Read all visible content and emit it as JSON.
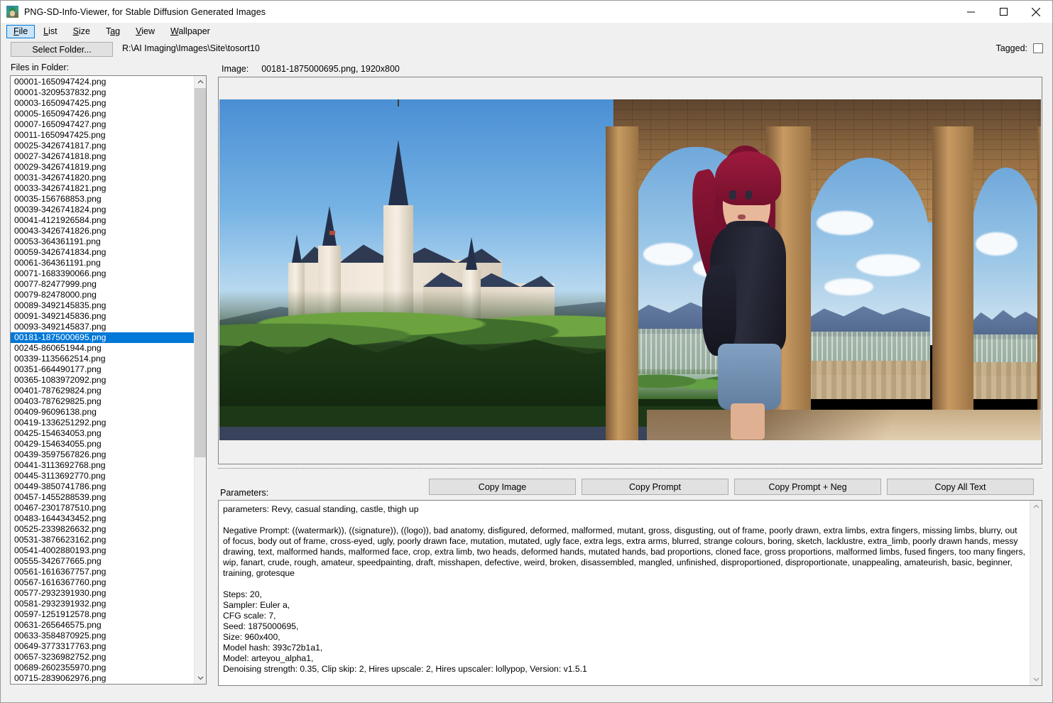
{
  "window": {
    "title": "PNG-SD-Info-Viewer, for Stable Diffusion Generated Images",
    "icon": "app-icon",
    "minimize_label": "Minimize",
    "maximize_label": "Maximize",
    "close_label": "Close"
  },
  "menu": {
    "items": [
      {
        "label": "File",
        "accel": "F",
        "focused": true
      },
      {
        "label": "List",
        "accel": "L",
        "focused": false
      },
      {
        "label": "Size",
        "accel": "S",
        "focused": false
      },
      {
        "label": "Tag",
        "accel": "a",
        "focused": false
      },
      {
        "label": "View",
        "accel": "V",
        "focused": false
      },
      {
        "label": "Wallpaper",
        "accel": "W",
        "focused": false
      }
    ]
  },
  "toolbar": {
    "select_folder_label": "Select Folder...",
    "folder_path": "R:\\AI Imaging\\Images\\Site\\tosort10",
    "tagged_label": "Tagged:",
    "tagged_checked": false
  },
  "file_panel": {
    "label": "Files in Folder:",
    "selected": "00181-1875000695.png",
    "files": [
      "00001-1650947424.png",
      "00001-3209537832.png",
      "00003-1650947425.png",
      "00005-1650947426.png",
      "00007-1650947427.png",
      "00011-1650947425.png",
      "00025-3426741817.png",
      "00027-3426741818.png",
      "00029-3426741819.png",
      "00031-3426741820.png",
      "00033-3426741821.png",
      "00035-156768853.png",
      "00039-3426741824.png",
      "00041-4121926584.png",
      "00043-3426741826.png",
      "00053-364361191.png",
      "00059-3426741834.png",
      "00061-364361191.png",
      "00071-1683390066.png",
      "00077-82477999.png",
      "00079-82478000.png",
      "00089-3492145835.png",
      "00091-3492145836.png",
      "00093-3492145837.png",
      "00181-1875000695.png",
      "00245-860651944.png",
      "00339-1135662514.png",
      "00351-664490177.png",
      "00365-1083972092.png",
      "00401-787629824.png",
      "00403-787629825.png",
      "00409-96096138.png",
      "00419-1336251292.png",
      "00425-154634053.png",
      "00429-154634055.png",
      "00439-3597567826.png",
      "00441-3113692768.png",
      "00445-3113692770.png",
      "00449-3850741786.png",
      "00457-1455288539.png",
      "00467-2301787510.png",
      "00483-1644343452.png",
      "00525-2339826632.png",
      "00531-3876623162.png",
      "00541-4002880193.png",
      "00555-342677665.png",
      "00561-1616367757.png",
      "00567-1616367760.png",
      "00577-2932391930.png",
      "00581-2932391932.png",
      "00597-1251912578.png",
      "00631-265646575.png",
      "00633-3584870925.png",
      "00649-3773317763.png",
      "00657-3236982752.png",
      "00689-2602355970.png",
      "00715-2839062976.png"
    ]
  },
  "preview": {
    "image_label": "Image:",
    "image_info": "00181-1875000695.png, 1920x800"
  },
  "actions": {
    "copy_image": "Copy Image",
    "copy_prompt": "Copy Prompt",
    "copy_prompt_neg": "Copy Prompt + Neg",
    "copy_all_text": "Copy All Text"
  },
  "parameters": {
    "label": "Parameters:",
    "prompt_line": "parameters: Revy, casual standing, castle, thigh up",
    "negative_prompt": "Negative Prompt: ((watermark)), ((signature)), ((logo)), bad anatomy, disfigured, deformed, malformed, mutant, gross, disgusting, out of frame, poorly drawn, extra limbs, extra fingers, missing limbs, blurry, out of focus, body out of frame, cross-eyed, ugly, poorly drawn face, mutation, mutated, ugly face, extra legs, extra arms, blurred, strange colours, boring, sketch, lacklustre, extra_limb, poorly drawn hands, messy drawing, text, malformed hands, malformed face, crop, extra limb, two heads, deformed hands, mutated hands, bad proportions, cloned face, gross proportions, malformed limbs, fused fingers, too many fingers, wip, fanart, crude, rough, amateur, speedpainting, draft, misshapen, defective, weird, broken, disassembled, mangled, unfinished, disproportioned, disproportionate, unappealing, amateurish, basic, beginner, training, grotesque",
    "settings": [
      "Steps: 20,",
      "Sampler: Euler a,",
      "CFG scale: 7,",
      "Seed: 1875000695,",
      "Size: 960x400,",
      "Model hash: 393c72b1a1,",
      "Model: arteyou_alpha1,",
      "Denoising strength: 0.35, Clip skip: 2, Hires upscale: 2, Hires upscaler: lollypop, Version: v1.5.1"
    ]
  },
  "colors": {
    "selection_blue": "#0078d7",
    "window_bg": "#f0f0f0",
    "panel_white": "#ffffff",
    "button_face": "#e1e1e1",
    "border_gray": "#828282"
  }
}
